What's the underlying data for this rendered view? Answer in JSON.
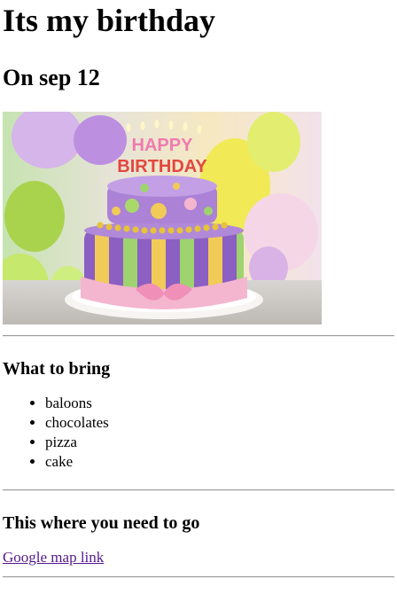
{
  "page": {
    "title": "Its my birthday",
    "date_heading": "On sep 12",
    "image": {
      "candles_text": "HAPPY BIRTHDAY"
    },
    "bring": {
      "heading": "What to bring",
      "items": [
        "baloons",
        "chocolates",
        "pizza",
        "cake"
      ]
    },
    "location": {
      "heading": "This where you need to go",
      "link_text": "Google map link"
    },
    "colors": {
      "link": "#551a8b",
      "rule": "#9a9a9a"
    }
  }
}
